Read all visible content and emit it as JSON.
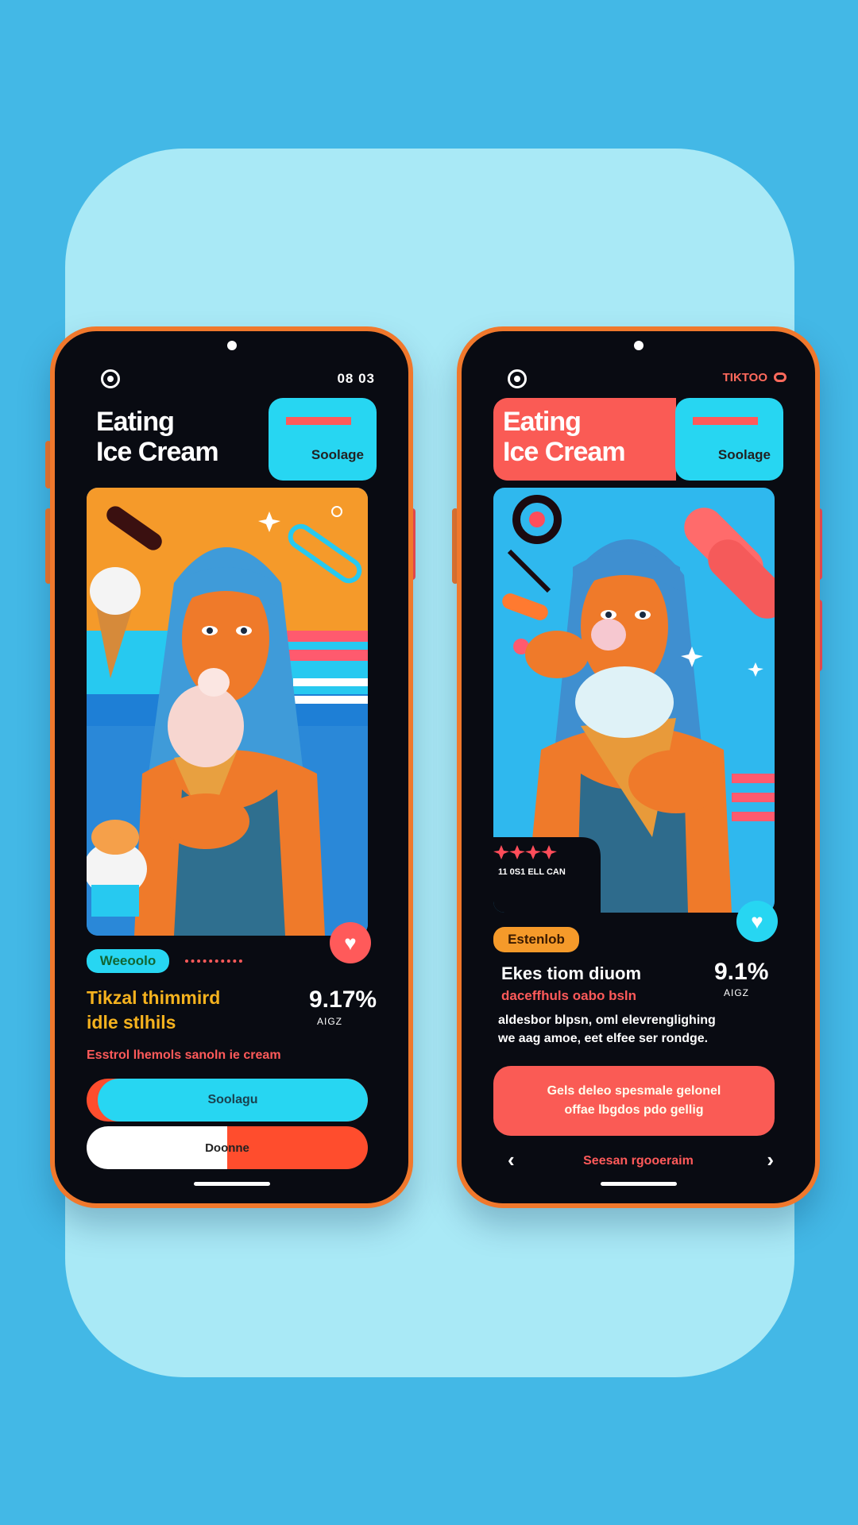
{
  "colors": {
    "background": "#43b8e6",
    "panel": "#a9e9f6",
    "phone_frame": "#f0782c",
    "screen": "#090b12",
    "cyan": "#27d6f2",
    "coral": "#fa5b55",
    "orange": "#f59a2a"
  },
  "left_phone": {
    "status_time": "08 03",
    "title_line1": "Eating",
    "title_line2": "Ice Cream",
    "chip_text": "Soolage",
    "tag": "Weeoolo",
    "headline_line1": "Tikzal thimmird",
    "headline_line2": "idle stlhils",
    "stat_value": "9.17%",
    "stat_label": "AIGZ",
    "caption": "Esstrol lhemols sanoln ie cream",
    "button_primary": "Soolagu",
    "button_secondary": "Doonne"
  },
  "right_phone": {
    "status_app": "TIKTOO",
    "title_line1": "Eating",
    "title_line2": "Ice Cream",
    "chip_text": "Soolage",
    "rating_text": "11 0S1  ELL CAN",
    "tag": "Estenlob",
    "headline_line1": "Ekes tiom diuom",
    "headline_line2": "daceffhuls oabo bsln",
    "stat_value": "9.1%",
    "stat_label": "AIGZ",
    "paragraph_line1": "aldesbor blpsn, oml elevrenglighing",
    "paragraph_line2": "we aag amoe, eet elfee ser rondge.",
    "cta_line1": "Gels deleo spesmale gelonel",
    "cta_line2": "offae lbgdos pdo gellig",
    "nav_label": "Seesan rgooeraim",
    "nav_prev_icon": "chevron-left-icon",
    "nav_next_icon": "chevron-right-icon"
  }
}
